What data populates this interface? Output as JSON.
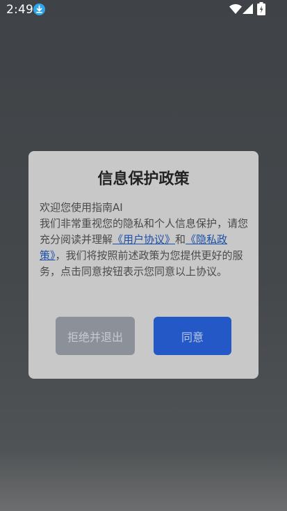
{
  "status_bar": {
    "time": "2:49",
    "icons": [
      "download-icon",
      "wifi-icon",
      "signal-icon",
      "battery-icon"
    ]
  },
  "dialog": {
    "title": "信息保护政策",
    "welcome": "欢迎您使用指南AI",
    "body_prefix": "我们非常重视您的隐私和个人信息保护，请您充分阅读并理解",
    "link_user_agreement": "《用户协议》",
    "body_and": "和",
    "link_privacy_policy": "《隐私政策》",
    "body_suffix": "，我们将按照前述政策为您提供更好的服务，点击同意按钮表示您同意以上协议。",
    "reject_label": "拒绝并退出",
    "agree_label": "同意"
  },
  "colors": {
    "agree_button": "#2458c6",
    "reject_button": "#8c9099",
    "link": "#1a4fa8"
  }
}
